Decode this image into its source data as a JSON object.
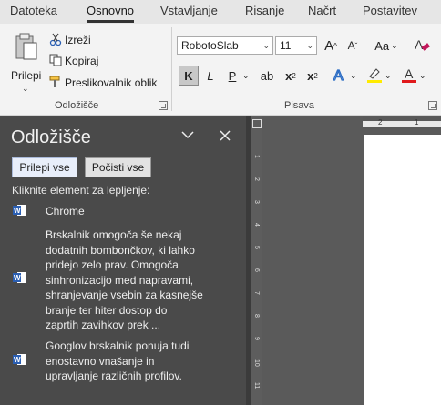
{
  "tabs": [
    "Datoteka",
    "Osnovno",
    "Vstavljanje",
    "Risanje",
    "Načrt",
    "Postavitev"
  ],
  "active_tab": "Osnovno",
  "clipboard_group": {
    "label": "Odložišče",
    "paste": "Prilepi",
    "cut": "Izreži",
    "copy": "Kopiraj",
    "format_painter": "Preslikovalnik oblik"
  },
  "font_group": {
    "label": "Pisava",
    "font_name": "RobotoSlab",
    "font_size": "11",
    "grow": "A",
    "shrink": "A",
    "case": "Aa",
    "bold": "K",
    "italic": "L",
    "underline": "P",
    "strike": "ab",
    "subscript": "x",
    "superscript": "x",
    "highlight_color": "#ffeb00",
    "font_color": "#e0191b"
  },
  "pane": {
    "title": "Odložišče",
    "paste_all": "Prilepi vse",
    "clear_all": "Počisti vse",
    "hint": "Kliknite element za lepljenje:",
    "items": [
      {
        "icon": "word-doc-icon",
        "lines": [
          "Chrome"
        ]
      },
      {
        "icon": "word-doc-icon",
        "lines": [
          "Brskalnik omogoča še nekaj",
          "dodatnih bombončkov, ki lahko",
          "pridejo zelo prav. Omogoča",
          "sinhronizacijo med napravami,",
          "shranjevanje vsebin za kasnejše",
          "branje ter hiter dostop do",
          "zaprtih zavihkov prek ..."
        ]
      },
      {
        "icon": "word-doc-icon",
        "lines": [
          "Googlov brskalnik ponuja tudi",
          "enostavno vnašanje in",
          "upravljanje različnih profilov."
        ]
      }
    ]
  },
  "hruler_labels": [
    "2",
    "1"
  ],
  "vruler_labels": [
    "1",
    "2",
    "3",
    "4",
    "5",
    "6",
    "7",
    "8",
    "9",
    "10",
    "11",
    "12"
  ]
}
